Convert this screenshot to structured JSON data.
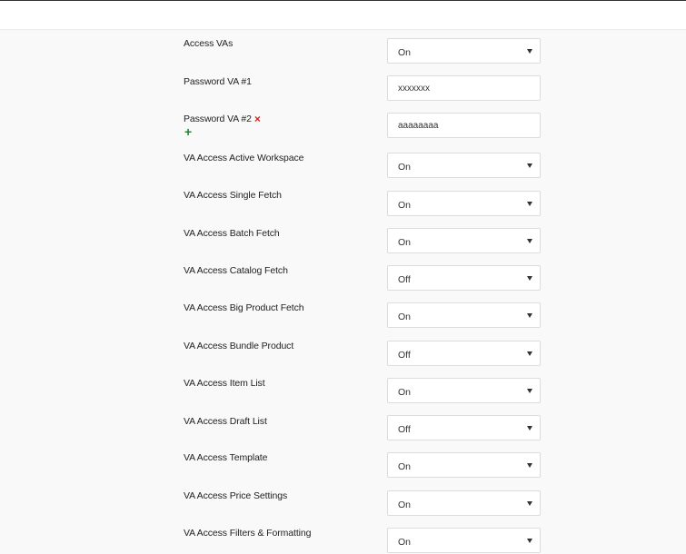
{
  "settings": [
    {
      "label": "Access VAs",
      "type": "select",
      "value": "On"
    },
    {
      "label": "Password VA #1",
      "type": "input",
      "value": "xxxxxxx"
    },
    {
      "label": "Password VA #2",
      "type": "input",
      "value": "aaaaaaaa",
      "remove_icon": "×",
      "add_icon": "+"
    },
    {
      "label": "VA Access Active Workspace",
      "type": "select",
      "value": "On"
    },
    {
      "label": "VA Access Single Fetch",
      "type": "select",
      "value": "On"
    },
    {
      "label": "VA Access Batch Fetch",
      "type": "select",
      "value": "On"
    },
    {
      "label": "VA Access Catalog Fetch",
      "type": "select",
      "value": "Off"
    },
    {
      "label": "VA Access Big Product Fetch",
      "type": "select",
      "value": "On"
    },
    {
      "label": "VA Access Bundle Product",
      "type": "select",
      "value": "Off"
    },
    {
      "label": "VA Access Item List",
      "type": "select",
      "value": "On"
    },
    {
      "label": "VA Access Draft List",
      "type": "select",
      "value": "Off"
    },
    {
      "label": "VA Access Template",
      "type": "select",
      "value": "On"
    },
    {
      "label": "VA Access Price Settings",
      "type": "select",
      "value": "On"
    },
    {
      "label": "VA Access Filters & Formatting",
      "type": "select",
      "value": "On"
    }
  ],
  "icons": {
    "remove": "remove-icon",
    "add": "add-icon",
    "caret": "chevron-down-icon"
  },
  "colors": {
    "remove_icon": "#e0201b",
    "add_icon": "#1d8a2f",
    "background": "#f9f9f9"
  }
}
